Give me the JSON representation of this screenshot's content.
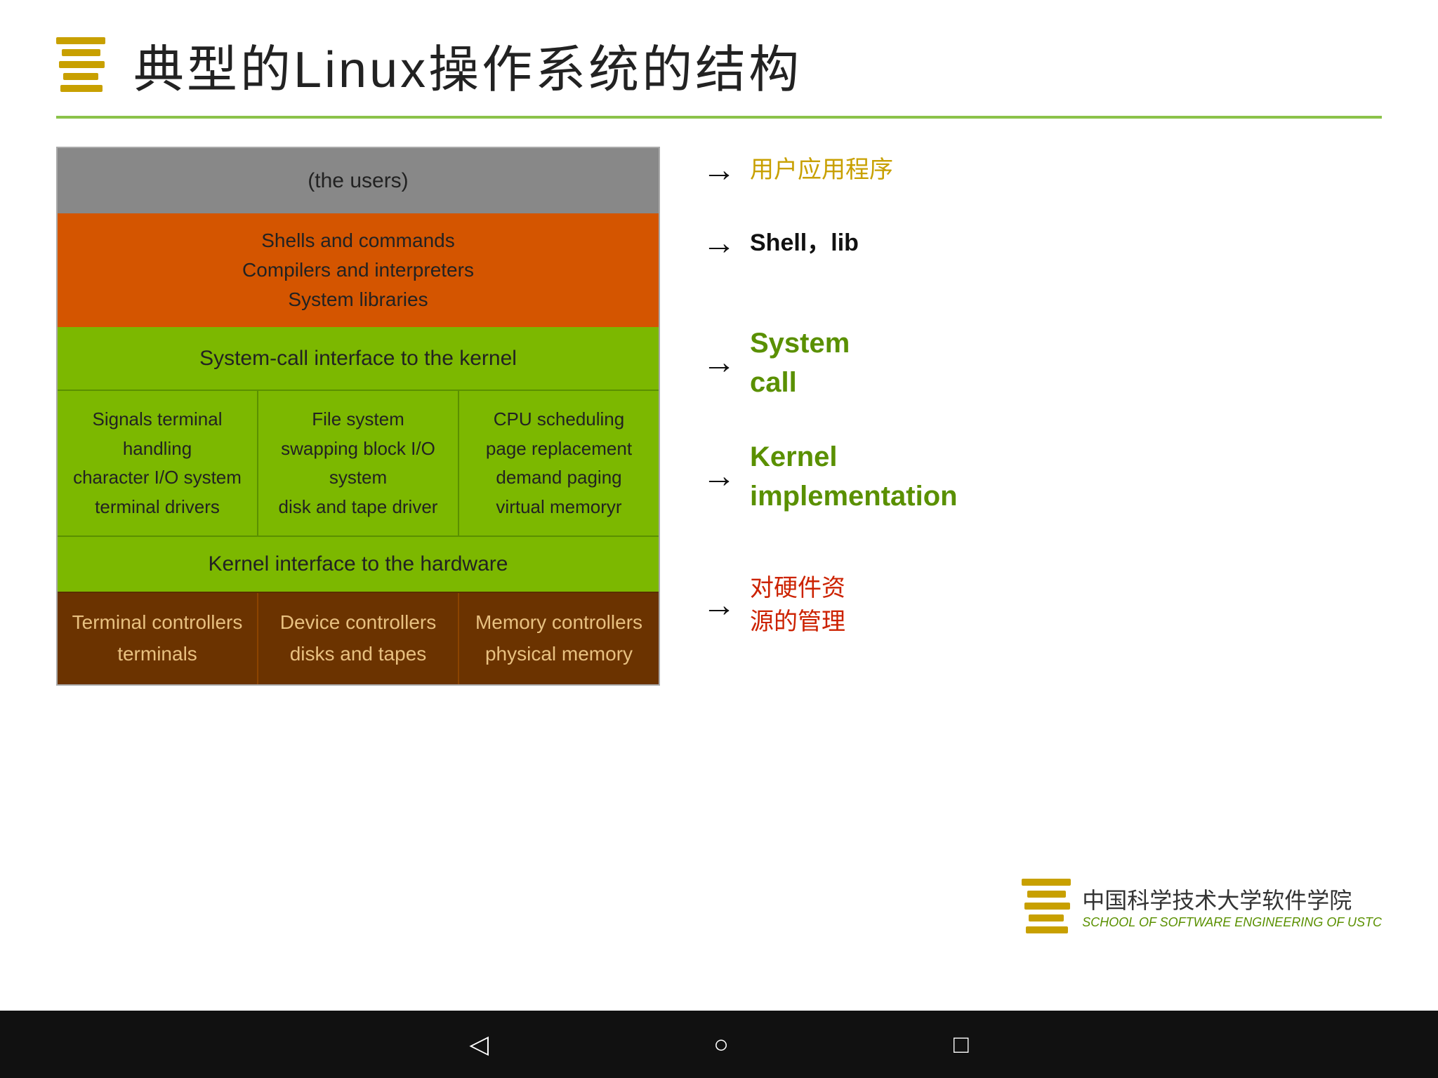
{
  "header": {
    "title": "典型的Linux操作系统的结构"
  },
  "diagram": {
    "users_label": "(the users)",
    "orange_line1": "Shells and commands",
    "orange_line2": "Compilers and interpreters",
    "orange_line3": "System libraries",
    "syscall_label": "System-call interface to the kernel",
    "kernel_col1_line1": "Signals terminal",
    "kernel_col1_line2": "handling",
    "kernel_col1_line3": "character I/O system",
    "kernel_col1_line4": "terminal    drivers",
    "kernel_col2_line1": "File system",
    "kernel_col2_line2": "swapping block I/O",
    "kernel_col2_line3": "system",
    "kernel_col2_line4": "disk and tape driver",
    "kernel_col3_line1": "CPU scheduling",
    "kernel_col3_line2": "page replacement",
    "kernel_col3_line3": "demand paging",
    "kernel_col3_line4": "virtual memoryr",
    "hw_interface_label": "Kernel interface to the hardware",
    "ctrl_col1_line1": "Terminal controllers",
    "ctrl_col1_line2": "terminals",
    "ctrl_col2_line1": "Device controllers",
    "ctrl_col2_line2": "disks and tapes",
    "ctrl_col3_line1": "Memory controllers",
    "ctrl_col3_line2": "physical memory"
  },
  "annotations": {
    "users_label": "用户应用程序",
    "shell_label": "Shell，lib",
    "syscall_line1": "System",
    "syscall_line2": "call",
    "kernel_line1": "Kernel",
    "kernel_line2": "implementation",
    "hw_line1": "对硬件资",
    "hw_line2": "源的管理"
  },
  "footer": {
    "cn_text": "中国科学技术大学软件学院",
    "en_text": "SCHOOL OF SOFTWARE ENGINEERING OF USTC"
  },
  "nav": {
    "back": "◁",
    "home": "○",
    "recent": "□"
  }
}
